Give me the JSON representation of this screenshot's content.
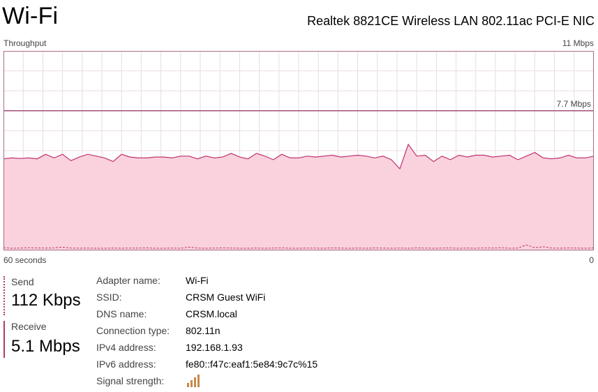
{
  "header": {
    "title": "Wi-Fi",
    "adapter": "Realtek 8821CE Wireless LAN 802.11ac PCI-E NIC"
  },
  "graph": {
    "label": "Throughput",
    "max_label": "11 Mbps",
    "ref_label": "7.7 Mbps",
    "time_left": "60 seconds",
    "time_right": "0"
  },
  "chart_data": {
    "type": "area",
    "ylim": [
      0,
      11
    ],
    "xlim": [
      60,
      0
    ],
    "reference_line": 7.7,
    "colors": {
      "receive": "#c0306f",
      "fill": "#f9d2dd",
      "grid": "#eadbe2",
      "ref": "#8b1a4d"
    },
    "series": [
      {
        "name": "Receive",
        "values": [
          5.05,
          5.1,
          5.07,
          5.1,
          5.05,
          5.3,
          5.1,
          5.3,
          4.95,
          5.15,
          5.3,
          5.2,
          5.1,
          4.9,
          5.3,
          5.15,
          5.1,
          5.1,
          5.15,
          5.15,
          5.1,
          5.2,
          5.2,
          5.05,
          5.2,
          5.1,
          5.15,
          5.35,
          5.15,
          5.05,
          5.35,
          5.2,
          5.0,
          5.3,
          5.1,
          5.1,
          5.2,
          5.15,
          5.2,
          5.25,
          5.15,
          5.2,
          5.25,
          5.2,
          5.1,
          5.2,
          5.0,
          4.5,
          5.85,
          5.2,
          5.25,
          4.9,
          5.2,
          5.0,
          5.25,
          5.15,
          5.25,
          5.25,
          5.15,
          5.2,
          5.25,
          5.0,
          5.2,
          5.4,
          5.1,
          5.05,
          5.1,
          5.25,
          5.1,
          5.1,
          5.2
        ]
      },
      {
        "name": "Send",
        "values": [
          0.15,
          0.12,
          0.13,
          0.15,
          0.14,
          0.13,
          0.14,
          0.18,
          0.13,
          0.12,
          0.13,
          0.12,
          0.12,
          0.13,
          0.12,
          0.13,
          0.13,
          0.14,
          0.12,
          0.12,
          0.13,
          0.12,
          0.18,
          0.13,
          0.12,
          0.13,
          0.14,
          0.13,
          0.12,
          0.12,
          0.13,
          0.12,
          0.13,
          0.14,
          0.12,
          0.12,
          0.13,
          0.13,
          0.12,
          0.14,
          0.13,
          0.12,
          0.13,
          0.12,
          0.14,
          0.13,
          0.12,
          0.13,
          0.12,
          0.14,
          0.13,
          0.12,
          0.13,
          0.14,
          0.12,
          0.13,
          0.12,
          0.14,
          0.13,
          0.15,
          0.12,
          0.13,
          0.3,
          0.15,
          0.2,
          0.13,
          0.12,
          0.14,
          0.13,
          0.12,
          0.14
        ]
      }
    ]
  },
  "metrics": {
    "send": {
      "label": "Send",
      "value": "112 Kbps",
      "color": "#b03a6a"
    },
    "receive": {
      "label": "Receive",
      "value": "5.1 Mbps",
      "color": "#b03a6a"
    }
  },
  "details": [
    {
      "key": "Adapter name:",
      "value": "Wi-Fi"
    },
    {
      "key": "SSID:",
      "value": "CRSM Guest WiFi"
    },
    {
      "key": "DNS name:",
      "value": "CRSM.local"
    },
    {
      "key": "Connection type:",
      "value": "802.11n"
    },
    {
      "key": "IPv4 address:",
      "value": "192.168.1.93"
    },
    {
      "key": "IPv6 address:",
      "value": "fe80::f47c:eaf1:5e84:9c7c%15"
    },
    {
      "key": "Signal strength:",
      "value": "",
      "signal_bars": 4
    }
  ]
}
